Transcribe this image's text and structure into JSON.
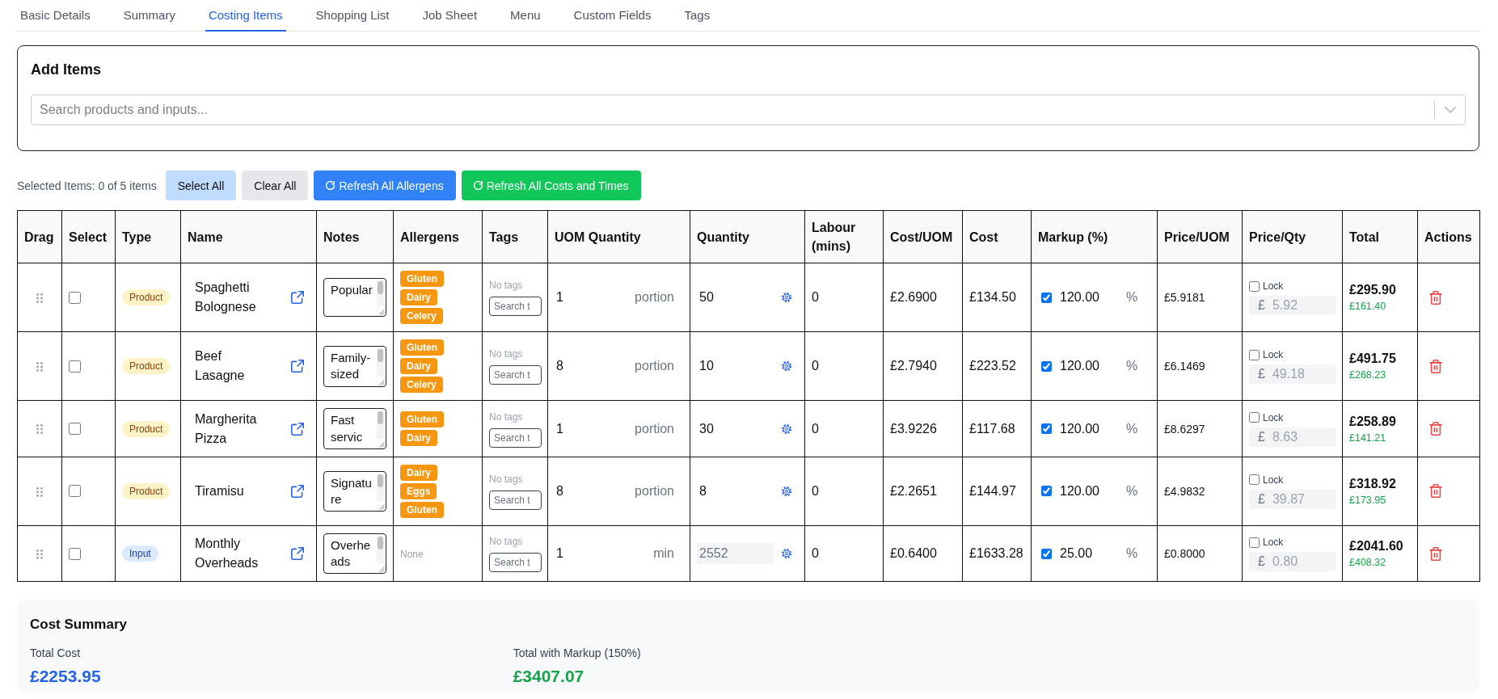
{
  "tabs": [
    {
      "label": "Basic Details",
      "selected": false
    },
    {
      "label": "Summary",
      "selected": false
    },
    {
      "label": "Costing Items",
      "selected": true
    },
    {
      "label": "Shopping List",
      "selected": false
    },
    {
      "label": "Job Sheet",
      "selected": false
    },
    {
      "label": "Menu",
      "selected": false
    },
    {
      "label": "Custom Fields",
      "selected": false
    },
    {
      "label": "Tags",
      "selected": false
    }
  ],
  "add_items": {
    "title": "Add Items",
    "search": {
      "placeholder": "Search products and inputs..."
    }
  },
  "toolbar": {
    "selection_text": "Selected Items: 0 of 5 items",
    "buttons": [
      {
        "label": "Select All",
        "kind": "select"
      },
      {
        "label": "Clear All",
        "kind": "clear"
      },
      {
        "label": "Refresh All Allergens",
        "kind": "refresh"
      },
      {
        "label": "Refresh All Costs and Times",
        "kind": "refresh_costs"
      }
    ]
  },
  "table": {
    "columns": [
      "Drag",
      "Select",
      "Type",
      "Name",
      "Notes",
      "Allergens",
      "Tags",
      "UOM Quantity",
      "Quantity",
      "Labour (mins)",
      "Cost/UOM",
      "Cost",
      "Markup (%)",
      "Price/UOM",
      "Price/Qty",
      "Total",
      "Actions"
    ],
    "rows": [
      {
        "selected": false,
        "type": {
          "label": "Product",
          "kind": "product"
        },
        "name": "Spaghetti Bolognese",
        "notes": "Popular",
        "allergens": [
          "Gluten",
          "Dairy",
          "Celery"
        ],
        "tags_text": "No tags",
        "tag_search_placeholder": "Search t",
        "uom_quantity": "1",
        "uom": "portion",
        "quantity": "50",
        "quantity_disabled": false,
        "labour": "0",
        "cost_per_uom": "£2.6900",
        "cost": "£134.50",
        "markup_on": true,
        "markup": "120.00",
        "markup_unit": "%",
        "price_per_uom": "£5.9181",
        "price_locked": false,
        "lock_label": "Lock",
        "currency": "£",
        "price_per_qty": "5.92",
        "total": "£295.90",
        "profit": "£161.40"
      },
      {
        "selected": false,
        "type": {
          "label": "Product",
          "kind": "product"
        },
        "name": "Beef Lasagne",
        "notes": "Family-sized",
        "allergens": [
          "Gluten",
          "Dairy",
          "Celery"
        ],
        "tags_text": "No tags",
        "tag_search_placeholder": "Search t",
        "uom_quantity": "8",
        "uom": "portion",
        "quantity": "10",
        "quantity_disabled": false,
        "labour": "0",
        "cost_per_uom": "£2.7940",
        "cost": "£223.52",
        "markup_on": true,
        "markup": "120.00",
        "markup_unit": "%",
        "price_per_uom": "£6.1469",
        "price_locked": false,
        "lock_label": "Lock",
        "currency": "£",
        "price_per_qty": "49.18",
        "total": "£491.75",
        "profit": "£268.23"
      },
      {
        "selected": false,
        "type": {
          "label": "Product",
          "kind": "product"
        },
        "name": "Margherita Pizza",
        "notes": "Fast servic",
        "allergens": [
          "Gluten",
          "Dairy"
        ],
        "tags_text": "No tags",
        "tag_search_placeholder": "Search t",
        "uom_quantity": "1",
        "uom": "portion",
        "quantity": "30",
        "quantity_disabled": false,
        "labour": "0",
        "cost_per_uom": "£3.9226",
        "cost": "£117.68",
        "markup_on": true,
        "markup": "120.00",
        "markup_unit": "%",
        "price_per_uom": "£8.6297",
        "price_locked": false,
        "lock_label": "Lock",
        "currency": "£",
        "price_per_qty": "8.63",
        "total": "£258.89",
        "profit": "£141.21"
      },
      {
        "selected": false,
        "type": {
          "label": "Product",
          "kind": "product"
        },
        "name": "Tiramisu",
        "notes": "Signature",
        "allergens": [
          "Dairy",
          "Eggs",
          "Gluten"
        ],
        "tags_text": "No tags",
        "tag_search_placeholder": "Search t",
        "uom_quantity": "8",
        "uom": "portion",
        "quantity": "8",
        "quantity_disabled": false,
        "labour": "0",
        "cost_per_uom": "£2.2651",
        "cost": "£144.97",
        "markup_on": true,
        "markup": "120.00",
        "markup_unit": "%",
        "price_per_uom": "£4.9832",
        "price_locked": false,
        "lock_label": "Lock",
        "currency": "£",
        "price_per_qty": "39.87",
        "total": "£318.92",
        "profit": "£173.95"
      },
      {
        "selected": false,
        "type": {
          "label": "Input",
          "kind": "input"
        },
        "name": "Monthly Overheads",
        "notes": "Overheads",
        "allergens_text": "None",
        "tags_text": "No tags",
        "tag_search_placeholder": "Search t",
        "uom_quantity": "1",
        "uom": "min",
        "quantity": "2552",
        "quantity_disabled": true,
        "labour": "0",
        "cost_per_uom": "£0.6400",
        "cost": "£1633.28",
        "markup_on": true,
        "markup": "25.00",
        "markup_unit": "%",
        "price_per_uom": "£0.8000",
        "price_locked": false,
        "lock_label": "Lock",
        "currency": "£",
        "price_per_qty": "0.80",
        "total": "£2041.60",
        "profit": "£408.32"
      }
    ]
  },
  "cost_summary": {
    "title": "Cost Summary",
    "items": [
      {
        "label": "Total Cost",
        "value": "£2253.95",
        "kind": "cost"
      },
      {
        "label": "Total with Markup (150%)",
        "value": "£3407.07",
        "kind": "markup"
      }
    ]
  }
}
